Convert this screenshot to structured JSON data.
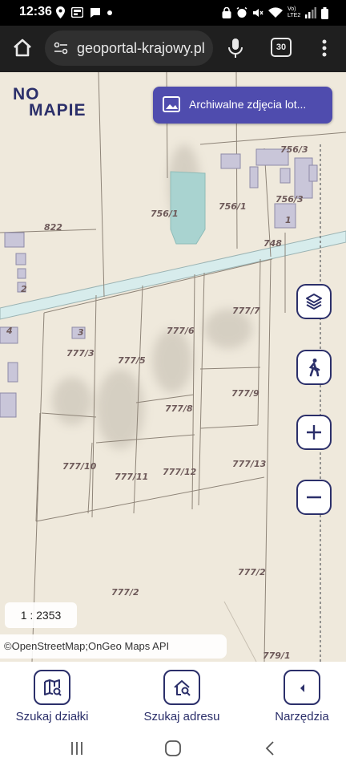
{
  "status_bar": {
    "time": "12:36",
    "left_icons": [
      "location-icon",
      "gallery-icon",
      "chat-icon",
      "dot-icon"
    ],
    "right_icons": [
      "lock-icon",
      "alarm-icon",
      "mute-icon",
      "wifi-icon",
      "signal-icon",
      "battery-icon"
    ],
    "network_label": "Vo) LTE2"
  },
  "browser": {
    "url": "geoportal-krajowy.pl",
    "tab_count": "30"
  },
  "map": {
    "logo_line1": "NO",
    "logo_line2": "MAPIE",
    "archive_button_label": "Archiwalne zdjęcia lot...",
    "scale": "1 : 2353",
    "attribution": "©OpenStreetMap;OnGeo Maps API",
    "parcel_labels": [
      "756/3",
      "756/3",
      "1",
      "756/1",
      "756/1",
      "822",
      "748",
      "2",
      "4",
      "3",
      "777/3",
      "777/6",
      "777/7",
      "777/5",
      "777/9",
      "777/8",
      "777/10",
      "777/11",
      "777/12",
      "777/13",
      "777/2",
      "777/2",
      "779/1"
    ],
    "side_buttons": [
      "layers-icon",
      "street-view-icon",
      "zoom-in-icon",
      "zoom-out-icon"
    ]
  },
  "toolbar": {
    "search_parcel_label": "Szukaj działki",
    "search_address_label": "Szukaj adresu",
    "tools_label": "Narzędzia"
  },
  "colors": {
    "brand": "#2b2f6a",
    "accent_button": "#4f4cae",
    "logo_dot": "#f2b51c",
    "map_background": "#efe9dc",
    "road": "#d7ecec"
  }
}
